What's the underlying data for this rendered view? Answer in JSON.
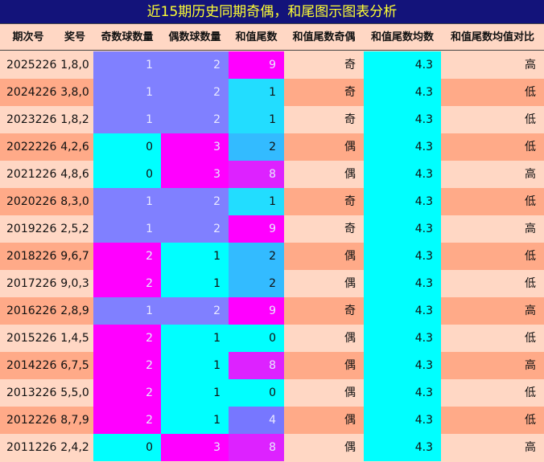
{
  "title": "近15期历史同期奇偶，和尾图示图表分析",
  "colors": {
    "title_bg": "#13137a",
    "title_text": "#ffff33",
    "row_light": "#ffd7c4",
    "row_dark": "#ffaa88",
    "count_blue": "#8080ff",
    "count_cyan": "#00ffff",
    "count_magenta": "#ff00ff",
    "tail_0": "#00ffff",
    "tail_1": "#22ddff",
    "tail_2": "#33bbff",
    "tail_4": "#7777ff",
    "tail_8": "#dd22ff",
    "tail_9": "#ff00ff",
    "avg_bg": "#00ffff"
  },
  "chart_data": {
    "type": "table",
    "title": "近15期历史同期奇偶，和尾图示图表分析",
    "columns": [
      "期次号",
      "奖号",
      "奇数球数量",
      "偶数球数量",
      "和值尾数",
      "和值尾数奇偶",
      "和值尾数均数",
      "和值尾数均值对比"
    ],
    "rows": [
      {
        "period": "2025226",
        "numbers": "1,8,0",
        "odd": "1",
        "even": "2",
        "tail": "9",
        "parity": "奇",
        "avg": "4.3",
        "compare": "高"
      },
      {
        "period": "2024226",
        "numbers": "3,8,0",
        "odd": "1",
        "even": "2",
        "tail": "1",
        "parity": "奇",
        "avg": "4.3",
        "compare": "低"
      },
      {
        "period": "2023226",
        "numbers": "1,8,2",
        "odd": "1",
        "even": "2",
        "tail": "1",
        "parity": "奇",
        "avg": "4.3",
        "compare": "低"
      },
      {
        "period": "2022226",
        "numbers": "4,2,6",
        "odd": "0",
        "even": "3",
        "tail": "2",
        "parity": "偶",
        "avg": "4.3",
        "compare": "低"
      },
      {
        "period": "2021226",
        "numbers": "4,8,6",
        "odd": "0",
        "even": "3",
        "tail": "8",
        "parity": "偶",
        "avg": "4.3",
        "compare": "高"
      },
      {
        "period": "2020226",
        "numbers": "8,3,0",
        "odd": "1",
        "even": "2",
        "tail": "1",
        "parity": "奇",
        "avg": "4.3",
        "compare": "低"
      },
      {
        "period": "2019226",
        "numbers": "2,5,2",
        "odd": "1",
        "even": "2",
        "tail": "9",
        "parity": "奇",
        "avg": "4.3",
        "compare": "高"
      },
      {
        "period": "2018226",
        "numbers": "9,6,7",
        "odd": "2",
        "even": "1",
        "tail": "2",
        "parity": "偶",
        "avg": "4.3",
        "compare": "低"
      },
      {
        "period": "2017226",
        "numbers": "9,0,3",
        "odd": "2",
        "even": "1",
        "tail": "2",
        "parity": "偶",
        "avg": "4.3",
        "compare": "低"
      },
      {
        "period": "2016226",
        "numbers": "2,8,9",
        "odd": "1",
        "even": "2",
        "tail": "9",
        "parity": "奇",
        "avg": "4.3",
        "compare": "高"
      },
      {
        "period": "2015226",
        "numbers": "1,4,5",
        "odd": "2",
        "even": "1",
        "tail": "0",
        "parity": "偶",
        "avg": "4.3",
        "compare": "低"
      },
      {
        "period": "2014226",
        "numbers": "6,7,5",
        "odd": "2",
        "even": "1",
        "tail": "8",
        "parity": "偶",
        "avg": "4.3",
        "compare": "高"
      },
      {
        "period": "2013226",
        "numbers": "5,5,0",
        "odd": "2",
        "even": "1",
        "tail": "0",
        "parity": "偶",
        "avg": "4.3",
        "compare": "低"
      },
      {
        "period": "2012226",
        "numbers": "8,7,9",
        "odd": "2",
        "even": "1",
        "tail": "4",
        "parity": "偶",
        "avg": "4.3",
        "compare": "低"
      },
      {
        "period": "2011226",
        "numbers": "2,4,2",
        "odd": "0",
        "even": "3",
        "tail": "8",
        "parity": "偶",
        "avg": "4.3",
        "compare": "高"
      }
    ]
  }
}
